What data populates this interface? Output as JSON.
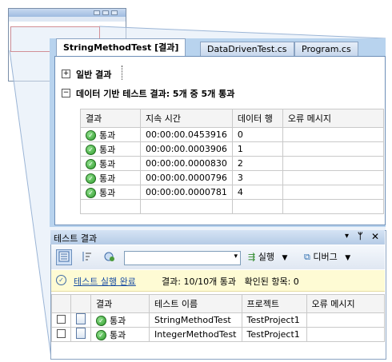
{
  "editor": {
    "tabs": [
      {
        "label": "StringMethodTest [결과]",
        "active": true
      },
      {
        "label": "DataDrivenTest.cs",
        "active": false
      },
      {
        "label": "Program.cs",
        "active": false
      }
    ],
    "general_section": {
      "expander": "+",
      "label": "일반 결과"
    },
    "data_section": {
      "expander": "−",
      "label": "데이터 기반 테스트 결과: 5개 중 5개 통과"
    },
    "grid": {
      "columns": [
        "결과",
        "지속 시간",
        "데이터 행",
        "오류 메시지"
      ],
      "rows": [
        {
          "result": "통과",
          "duration": "00:00:00.0453916",
          "row": "0",
          "error": ""
        },
        {
          "result": "통과",
          "duration": "00:00:00.0003906",
          "row": "1",
          "error": ""
        },
        {
          "result": "통과",
          "duration": "00:00:00.0000830",
          "row": "2",
          "error": ""
        },
        {
          "result": "통과",
          "duration": "00:00:00.0000796",
          "row": "3",
          "error": ""
        },
        {
          "result": "통과",
          "duration": "00:00:00.0000781",
          "row": "4",
          "error": ""
        }
      ]
    }
  },
  "test_results": {
    "title": "테스트 결과",
    "title_buttons": [
      "▾",
      "ᛘ",
      "✕"
    ],
    "toolbar": {
      "run_label": "실행",
      "debug_label": "디버그",
      "combo_value": ""
    },
    "infobar": {
      "link": "테스트 실행 완료",
      "summary": "결과: 10/10개 통과   확인된 항목: 0"
    },
    "columns": [
      "결과",
      "테스트 이름",
      "프로젝트",
      "오류 메시지"
    ],
    "rows": [
      {
        "result": "통과",
        "name": "StringMethodTest",
        "project": "TestProject1",
        "error": ""
      },
      {
        "result": "통과",
        "name": "IntegerMethodTest",
        "project": "TestProject1",
        "error": ""
      }
    ]
  },
  "colors": {
    "accent": "#b8d3ee",
    "highlight": "#c42323",
    "pass": "#2f9b2c",
    "infobar": "#fefbd4"
  }
}
